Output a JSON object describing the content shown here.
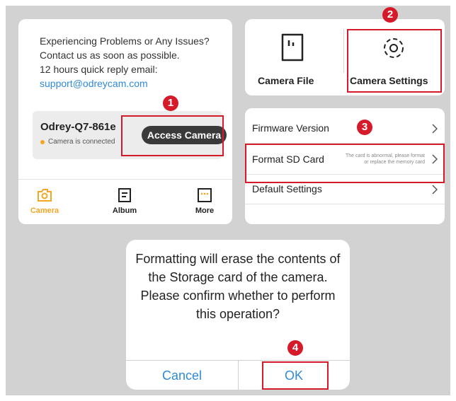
{
  "home": {
    "contact_lines": [
      "Experiencing Problems or Any Issues?",
      "Contact us as soon as possible.",
      "12 hours quick reply email:"
    ],
    "email": "support@odreycam.com",
    "device_name": "Odrey-Q7-861e",
    "device_status": "Camera is connected",
    "access_button": "Access Camera",
    "tabs": [
      {
        "label": "Camera",
        "icon": "camera-icon",
        "active": true
      },
      {
        "label": "Album",
        "icon": "album-icon",
        "active": false
      },
      {
        "label": "More",
        "icon": "more-icon",
        "active": false
      }
    ]
  },
  "settings": {
    "camera_file": "Camera File",
    "camera_settings": "Camera Settings"
  },
  "menu": {
    "items": [
      {
        "label": "Firmware Version",
        "note": ""
      },
      {
        "label": "Format SD Card",
        "note": "The card is abnormal, please format or replace the memory card"
      },
      {
        "label": "Default Settings",
        "note": ""
      }
    ]
  },
  "dialog": {
    "message": "Formatting will erase the contents of the Storage card of the camera. Please confirm whether to perform this operation?",
    "cancel": "Cancel",
    "ok": "OK"
  },
  "steps": [
    "1",
    "2",
    "3",
    "4"
  ],
  "colors": {
    "accent": "#f5a623",
    "link": "#2f8ad8",
    "highlight": "#d51b2a",
    "button_dark": "#3a3a3a"
  }
}
